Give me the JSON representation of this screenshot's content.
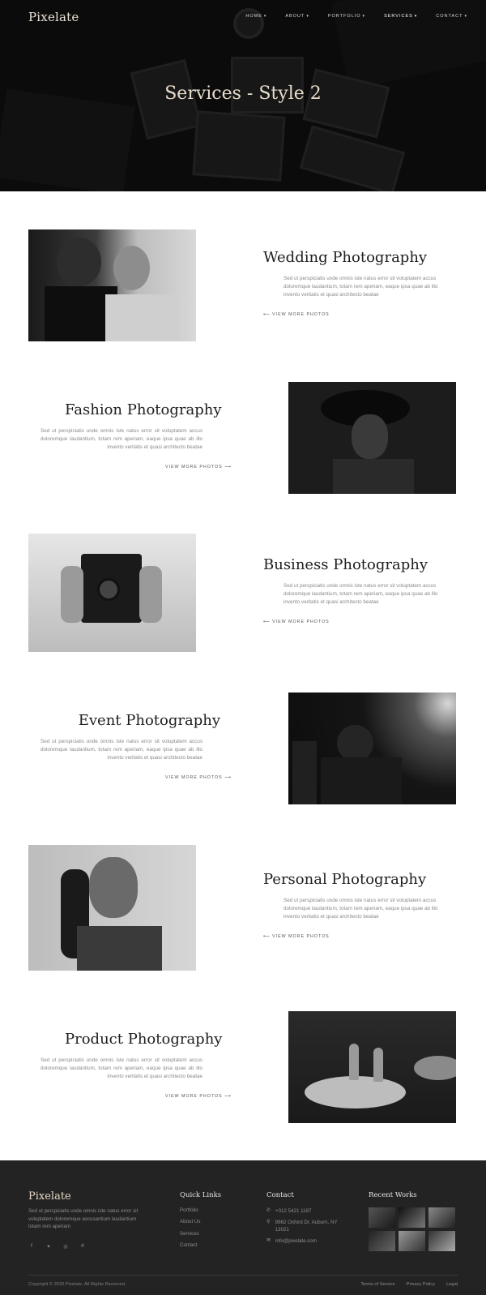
{
  "header": {
    "logo": "Pixelate",
    "nav": [
      {
        "label": "HOME"
      },
      {
        "label": "ABOUT"
      },
      {
        "label": "PORTFOLIO"
      },
      {
        "label": "SERVICES"
      },
      {
        "label": "CONTACT"
      }
    ],
    "active_nav": "SERVICES"
  },
  "hero": {
    "title": "Services - Style 2"
  },
  "services": [
    {
      "title": "Wedding Photography",
      "description": "Sed ut perspiciatis unde omnis iste natus error sit voluptatem accus doloremque laudantium, totam rem aperiam, eaque ipsa quae ab illo invento veritatis et quasi architecto beatae",
      "link": "VIEW MORE PHOTOS",
      "image": "couple-photo"
    },
    {
      "title": "Fashion Photography",
      "description": "Sed ut perspiciatis unde omnis iste natus error sit voluptatem accus doloremque laudantium, totam rem aperiam, eaque ipsa quae ab illo invento veritatis et quasi architecto beatae",
      "link": "VIEW MORE PHOTOS",
      "image": "fashion-photo"
    },
    {
      "title": "Business Photography",
      "description": "Sed ut perspiciatis unde omnis iste natus error sit voluptatem accus doloremque laudantium, totam rem aperiam, eaque ipsa quae ab illo invento veritatis et quasi architecto beatae",
      "link": "VIEW MORE PHOTOS",
      "image": "camera-photo"
    },
    {
      "title": "Event Photography",
      "description": "Sed ut perspiciatis unde omnis iste natus error sit voluptatem accus doloremque laudantium, totam rem aperiam, eaque ipsa quae ab illo invento veritatis et quasi architecto beatae",
      "link": "VIEW MORE PHOTOS",
      "image": "concert-photo"
    },
    {
      "title": "Personal Photography",
      "description": "Sed ut perspiciatis unde omnis iste natus error sit voluptatem accus doloremque laudantium, totam rem aperiam, eaque ipsa quae ab illo invento veritatis et quasi architecto beatae",
      "link": "VIEW MORE PHOTOS",
      "image": "portrait-photo"
    },
    {
      "title": "Product Photography",
      "description": "Sed ut perspiciatis unde omnis iste natus error sit voluptatem accus doloremque laudantium, totam rem aperiam, eaque ipsa quae ab illo invento veritatis et quasi architecto beatae",
      "link": "VIEW MORE PHOTOS",
      "image": "glasses-photo"
    }
  ],
  "footer": {
    "logo": "Pixelate",
    "about": "Sed ut perspiciatis unde omnis iste natus error sit voluptatem doloremque accusantium laudantium totam rem aperiam",
    "social": [
      "facebook-icon",
      "twitter-icon",
      "instagram-icon",
      "pinterest-icon"
    ],
    "quick_links_heading": "Quick Links",
    "quick_links": [
      "Portfolio",
      "About Us",
      "Services",
      "Contact"
    ],
    "contact_heading": "Contact",
    "phone": "+012 5421 1187",
    "address": "9962 Oxford Dr. Auburn, NY 13021",
    "email": "info@pixelate.com",
    "recent_heading": "Recent Works",
    "copyright": "Copyright © 2020 Pixelate. All Rights Reserved.",
    "legal": [
      "Terms of Service",
      "Privacy Policy",
      "Legal"
    ]
  }
}
